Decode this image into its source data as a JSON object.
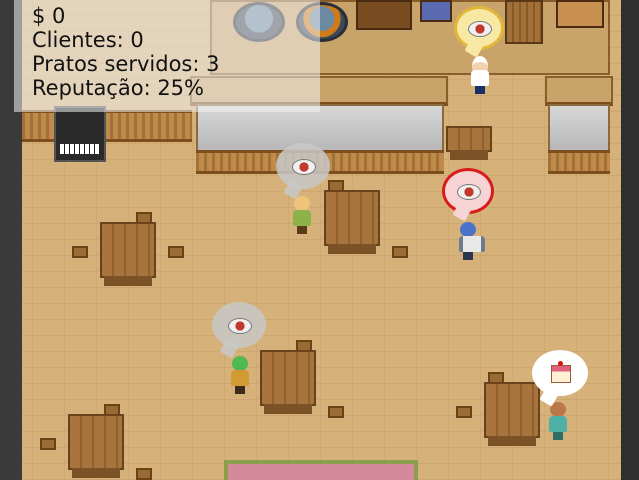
{
  "hud": {
    "money": "$ 0",
    "clientes": "Clientes: 0",
    "pratos_servidos": "Pratos servidos: 3",
    "reputacao": "Reputação: 25%"
  },
  "scene": {
    "orders": [
      {
        "who": "chef",
        "item": "plate-dish-icon",
        "bubble": "yellow"
      },
      {
        "who": "customer-blonde-girl",
        "item": "plate-dish-icon",
        "bubble": "gray"
      },
      {
        "who": "waiter-blue-hair",
        "item": "plate-dish-icon",
        "bubble": "red"
      },
      {
        "who": "customer-green-hair",
        "item": "plate-dish-icon",
        "bubble": "gray"
      },
      {
        "who": "customer-brown-hair-girl",
        "item": "cake-icon",
        "bubble": "white"
      }
    ]
  },
  "colors": {
    "floor": "#d6b27a",
    "wall_wood": "#a27138",
    "counter": "#c8c8c8",
    "bubble_red": "#d81b1b",
    "bubble_yellow": "#e2b63a"
  }
}
